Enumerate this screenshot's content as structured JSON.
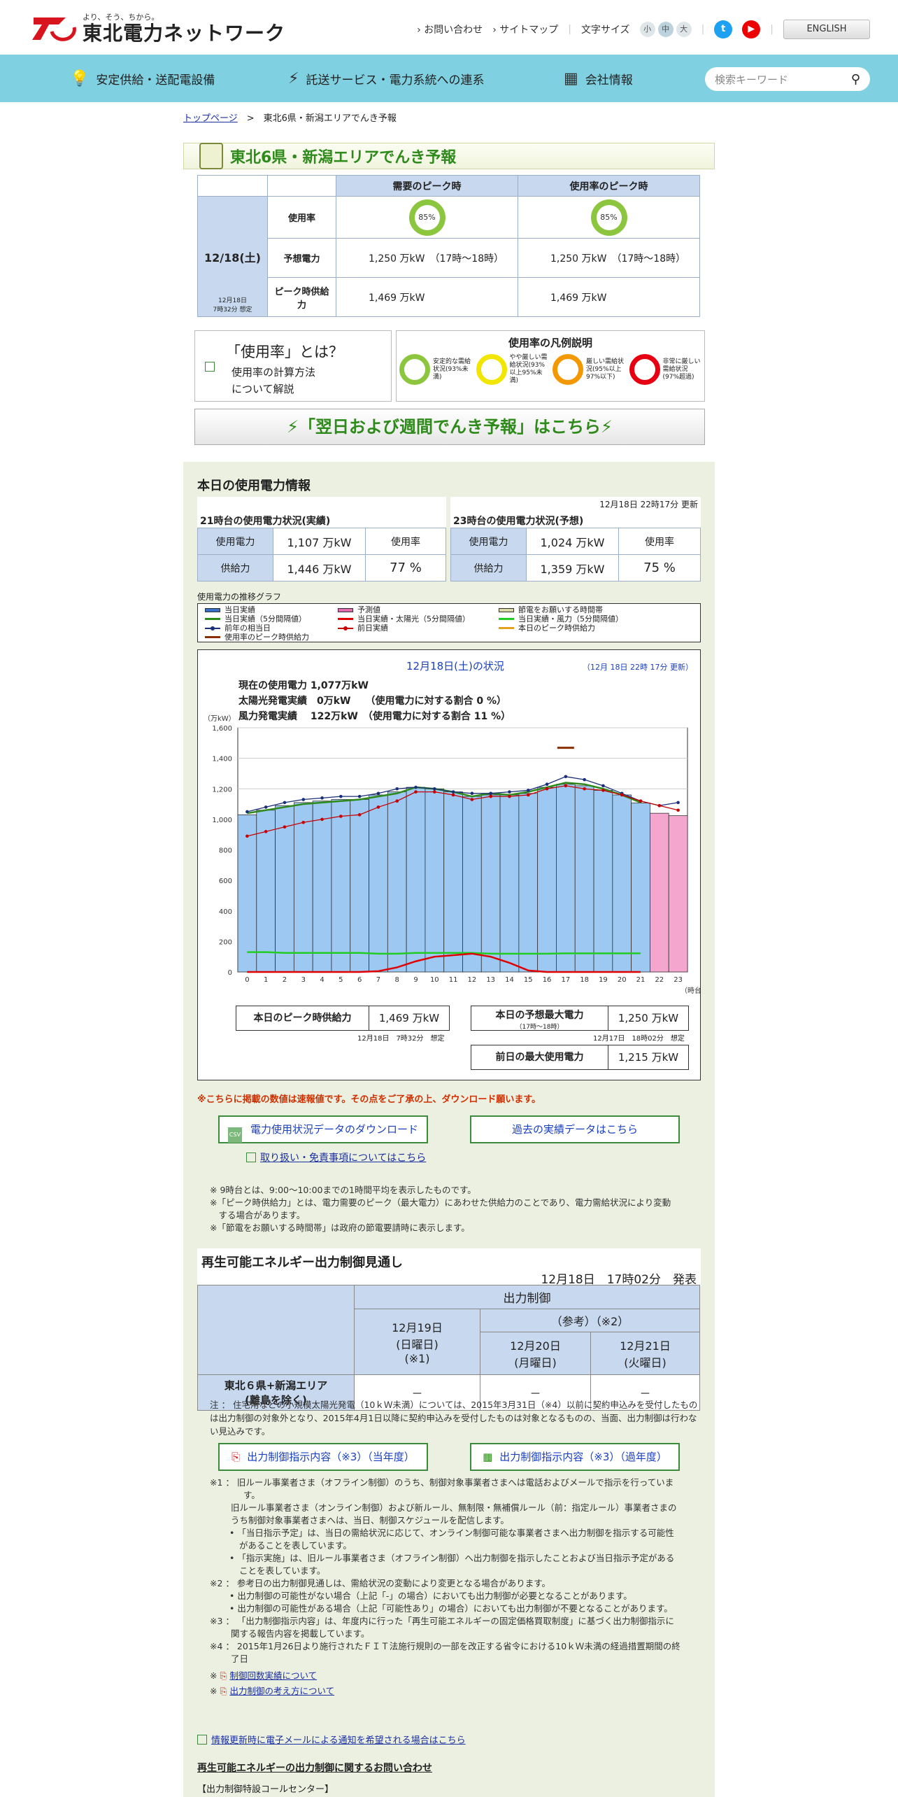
{
  "header": {
    "tagline": "より、そう、ちから。",
    "company": "東北電力ネットワーク",
    "links": [
      "お問い合わせ",
      "サイトマップ"
    ],
    "font_size_label": "文字サイズ",
    "font_sizes": [
      "小",
      "中",
      "大"
    ],
    "english": "ENGLISH"
  },
  "nav": {
    "items": [
      "安定供給・送配電設備",
      "託送サービス・電力系統への連系",
      "会社情報"
    ],
    "search_placeholder": "検索キーワード"
  },
  "breadcrumb": {
    "home": "トップページ",
    "current": "東北6県・新潟エリアでんき予報"
  },
  "title": "東北6県・新潟エリアでんき予報",
  "forecast": {
    "date": "12/18(土)",
    "updated": "12月18日\n7時32分 想定",
    "col_demand": "需要のピーク時",
    "col_rate": "使用率のピーク時",
    "row_rate": "使用率",
    "row_pred": "予想電力",
    "row_supply": "ピーク時供給力",
    "rate1": "85%",
    "rate2": "85%",
    "pred1": "1,250 万kW　（17時～18時）",
    "pred2": "1,250 万kW　（17時～18時）",
    "supply1": "1,469 万kW",
    "supply2": "1,469 万kW"
  },
  "what": {
    "title": "「使用率」とは？",
    "line1": "使用率の計算方法",
    "line2": "について解説"
  },
  "legend_rate": {
    "title": "使用率の凡例説明",
    "items": [
      {
        "label": "安定的な需給状況(93%未満)",
        "color": "#8cc63f"
      },
      {
        "label": "やや厳しい需給状況(93%以上95%未満)",
        "color": "#f2e600"
      },
      {
        "label": "厳しい需給状況(95%以上97%以下)",
        "color": "#f39800"
      },
      {
        "label": "非常に厳しい需給状況(97%超過)",
        "color": "#e60012"
      }
    ]
  },
  "week_banner": "「翌日および週間でんき予報」はこちら",
  "today": {
    "title": "本日の使用電力情報",
    "updated": "12月18日 22時17分 更新",
    "actual": {
      "title": "21時台の使用電力状況(実績)",
      "use_label": "使用電力",
      "use": "1,107 万kW",
      "sup_label": "供給力",
      "sup": "1,446 万kW",
      "rate_label": "使用率",
      "rate": "77 %"
    },
    "forecast": {
      "title": "23時台の使用電力状況(予想)",
      "use_label": "使用電力",
      "use": "1,024 万kW",
      "sup_label": "供給力",
      "sup": "1,359 万kW",
      "rate_label": "使用率",
      "rate": "75 %"
    }
  },
  "graph_label": "使用電力の推移グラフ",
  "legend": [
    {
      "label": "当日実績",
      "color": "#3a6fc8",
      "kind": "bar"
    },
    {
      "label": "予測値",
      "color": "#e26ab0",
      "kind": "bar"
    },
    {
      "label": "節電をお願いする時間帯",
      "color": "#d8d8a0",
      "kind": "bar"
    },
    {
      "label": "当日実績（5分間隔値）",
      "color": "#2e8a1a",
      "kind": "line"
    },
    {
      "label": "当日実績・太陽光（5分間隔値）",
      "color": "#e00000",
      "kind": "line"
    },
    {
      "label": "当日実績・風力（5分間隔値）",
      "color": "#22cc22",
      "kind": "line"
    },
    {
      "label": "前年の相当日",
      "color": "#1a2f7a",
      "kind": "dot"
    },
    {
      "label": "前日実績",
      "color": "#c80000",
      "kind": "dot"
    },
    {
      "label": "本日のピーク時供給力",
      "color": "#e8a020",
      "kind": "line"
    },
    {
      "label": "使用率のピーク時供給力",
      "color": "#8a2e00",
      "kind": "line"
    }
  ],
  "chart_meta": {
    "title": "12月18日(土)の状況",
    "updated": "（12月 18日 22時 17分 更新）",
    "line1": "現在の使用電力 1,077万kW",
    "line2": "太陽光発電実績　0万kW　　（使用電力に対する割合 0 %）",
    "line3": "風力発電実績　 122万kW　（使用電力に対する割合 11 %）",
    "yunit": "（万kW）",
    "xunit": "（時台）"
  },
  "chart_data": {
    "type": "bar",
    "title": "12月18日(土)の状況",
    "xlabel": "（時台）",
    "ylabel": "（万kW）",
    "ylim": [
      0,
      1600
    ],
    "categories": [
      "0",
      "1",
      "2",
      "3",
      "4",
      "5",
      "6",
      "7",
      "8",
      "9",
      "10",
      "11",
      "12",
      "13",
      "14",
      "15",
      "16",
      "17",
      "18",
      "19",
      "20",
      "21",
      "22",
      "23"
    ],
    "yticks": [
      0,
      200,
      400,
      600,
      800,
      1000,
      1200,
      1400,
      1600
    ],
    "series": [
      {
        "name": "当日実績",
        "kind": "bar",
        "values": [
          1030,
          1060,
          1090,
          1110,
          1120,
          1130,
          1130,
          1160,
          1180,
          1210,
          1200,
          1180,
          1150,
          1160,
          1160,
          1170,
          1210,
          1230,
          1220,
          1190,
          1160,
          1107,
          null,
          null
        ]
      },
      {
        "name": "予測値",
        "kind": "bar",
        "values": [
          null,
          null,
          null,
          null,
          null,
          null,
          null,
          null,
          null,
          null,
          null,
          null,
          null,
          null,
          null,
          null,
          null,
          null,
          null,
          null,
          null,
          null,
          1040,
          1024
        ]
      },
      {
        "name": "当日実績（5分間隔値）",
        "kind": "line",
        "values": [
          1040,
          1060,
          1080,
          1100,
          1110,
          1120,
          1130,
          1150,
          1170,
          1210,
          1200,
          1180,
          1150,
          1170,
          1160,
          1180,
          1210,
          1240,
          1230,
          1200,
          1160,
          1110,
          null,
          null
        ]
      },
      {
        "name": "前年の相当日",
        "kind": "dot",
        "values": [
          1050,
          1080,
          1110,
          1130,
          1140,
          1150,
          1150,
          1170,
          1200,
          1210,
          1200,
          1180,
          1170,
          1170,
          1180,
          1190,
          1230,
          1280,
          1260,
          1220,
          1170,
          1120,
          1090,
          1110
        ]
      },
      {
        "name": "前日実績",
        "kind": "dot",
        "values": [
          890,
          920,
          950,
          980,
          1000,
          1020,
          1030,
          1080,
          1120,
          1180,
          1180,
          1160,
          1130,
          1150,
          1150,
          1160,
          1200,
          1220,
          1200,
          1190,
          1160,
          1120,
          1090,
          1060
        ]
      },
      {
        "name": "当日実績・風力（5分間隔値）",
        "kind": "line",
        "values": [
          130,
          130,
          125,
          125,
          125,
          125,
          125,
          120,
          120,
          125,
          125,
          125,
          125,
          120,
          120,
          120,
          120,
          122,
          122,
          122,
          122,
          122,
          null,
          null
        ]
      },
      {
        "name": "当日実績・太陽光（5分間隔値）",
        "kind": "line",
        "values": [
          0,
          0,
          0,
          0,
          0,
          0,
          0,
          5,
          30,
          70,
          100,
          110,
          120,
          100,
          60,
          10,
          0,
          0,
          0,
          0,
          0,
          0,
          null,
          null
        ]
      },
      {
        "name": "使用率のピーク時供給力",
        "kind": "mark",
        "values": [
          null,
          null,
          null,
          null,
          null,
          null,
          null,
          null,
          null,
          null,
          null,
          null,
          null,
          null,
          null,
          null,
          null,
          1469,
          null,
          null,
          null,
          null,
          null,
          null
        ]
      }
    ]
  },
  "peak_box": {
    "supply_label": "本日のピーク時供給力",
    "supply": "1,469 万kW",
    "supply_note": "12月18日　7時32分　想定",
    "pred_label": "本日の予想最大電力",
    "pred_sub": "（17時～18時）",
    "pred": "1,250 万kW",
    "pred_note": "12月17日　18時02分　想定",
    "prev_label": "前日の最大使用電力",
    "prev": "1,215 万kW"
  },
  "warn": "※こちらに掲載の数値は速報値です。その点をご了承の上、ダウンロード願います。",
  "btn_download": "電力使用状況データのダウンロード",
  "btn_past": "過去の実績データはこちら",
  "link_terms": "取り扱い・免責事項についてはこちら",
  "notes": [
    "※ 9時台とは、9:00～10:00までの1時間平均を表示したものです。",
    "※「ピーク時供給力」とは、電力需要のピーク（最大電力）にあわせた供給力のことであり、電力需給状況により変動",
    "　する場合があります。",
    "※「節電をお願いする時間帯」は政府の節電要請時に表示します。"
  ],
  "renew": {
    "title": "再生可能エネルギー出力制御見通し",
    "stamp": "12月18日　17時02分　発表",
    "head": "出力制御",
    "ref": "（参考）（※2）",
    "d1": "12月19日\n(日曜日)\n(※1)",
    "d2": "12月20日\n(月曜日)",
    "d3": "12月21日\n(火曜日)",
    "area": "東北６県+新潟エリア\n(離島を除く)",
    "v1": "－",
    "v2": "－",
    "v3": "－"
  },
  "renew_note": "注 ： 住宅用などの小規模太陽光発電（10ｋＷ未満）については、2015年3月31日（※4）以前に契約申込みを受付したものは出力制御の対象外となり、2015年4月1日以降に契約申込みを受付したものは対象となるものの、当面、出力制御は行わない見込みです。",
  "btn_pdf": "出力制御指示内容（※3）（当年度）",
  "btn_xls": "出力制御指示内容（※3）（過年度）",
  "fn": [
    "※1 ： 旧ルール事業者さま（オフライン制御）のうち、制御対象事業者さまへは電話およびメールで指示を行っていま",
    "す。",
    "旧ルール事業者さま（オンライン制御）および新ルール、無制限・無補償ルール（前：指定ルール）事業者さまの",
    "うち制御対象事業者さまへは、当日、制御スケジュールを配信します。"
  ],
  "fn_b": [
    "「当日指示予定」は、当日の需給状況に応じて、オンライン制御可能な事業者さまへ出力制御を指示する可能性",
    "があることを表しています。",
    "「指示実施」は、旧ルール事業者さま（オフライン制御）へ出力制御を指示したことおよび当日指示予定がある",
    "ことを表しています。"
  ],
  "fn2": [
    "※2 ： 参考日の出力制御見通しは、需給状況の変動により変更となる場合があります。",
    "出力制御の可能性がない場合（上記「-」の場合）においても出力制御が必要となることがあります。",
    "出力制御の可能性がある場合（上記「可能性あり」の場合）においても出力制御が不要となることがあります。"
  ],
  "fn3": [
    "※3 ： 「出力制御指示内容」は、年度内に行った「再生可能エネルギーの固定価格買取制度」に基づく出力制御指示に",
    "関する報告内容を掲載しています。",
    "※4 ： 2015年1月26日より施行されたＦＩＴ法施行規則の一部を改正する省令における10ｋＷ未満の経過措置期間の終",
    "了日"
  ],
  "links2": [
    "制御回数実績について",
    "出力制御の考え方について"
  ],
  "mail_link": "情報更新時に電子メールによる通知を希望される場合はこちら",
  "contact_title": "再生可能エネルギーの出力制御に関するお問い合わせ",
  "contact_sub": "【出力制御特設コールセンター】"
}
